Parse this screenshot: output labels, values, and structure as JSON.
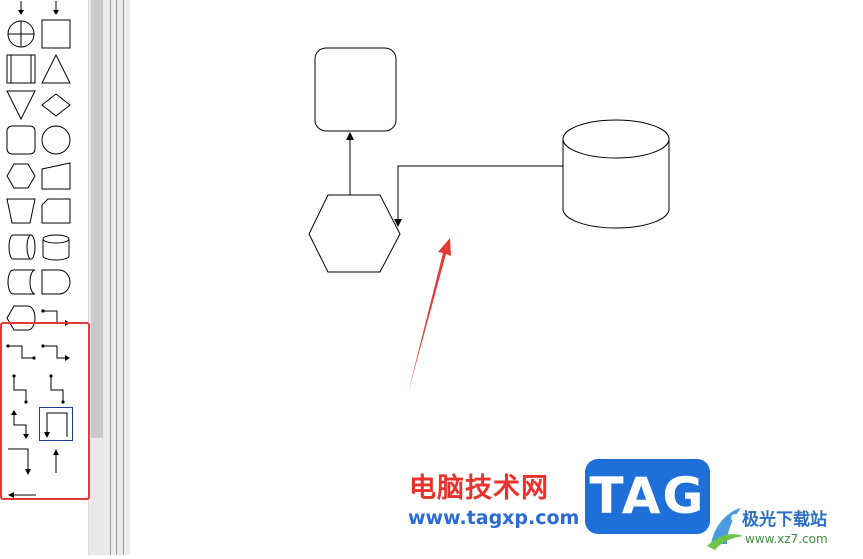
{
  "palette": {
    "items": [
      {
        "row": 0,
        "col": 0,
        "icon": "down-arrow-icon"
      },
      {
        "row": 0,
        "col": 1,
        "icon": "down-arrow-icon"
      },
      {
        "row": 1,
        "col": 0,
        "icon": "summing-junction-icon"
      },
      {
        "row": 1,
        "col": 1,
        "icon": "square-icon"
      },
      {
        "row": 2,
        "col": 0,
        "icon": "predefined-process-icon"
      },
      {
        "row": 2,
        "col": 1,
        "icon": "triangle-icon"
      },
      {
        "row": 3,
        "col": 0,
        "icon": "inverted-triangle-icon"
      },
      {
        "row": 3,
        "col": 1,
        "icon": "diamond-icon"
      },
      {
        "row": 4,
        "col": 0,
        "icon": "rounded-square-icon"
      },
      {
        "row": 4,
        "col": 1,
        "icon": "circle-icon"
      },
      {
        "row": 5,
        "col": 0,
        "icon": "hexagon-icon"
      },
      {
        "row": 5,
        "col": 1,
        "icon": "manual-input-icon"
      },
      {
        "row": 6,
        "col": 0,
        "icon": "manual-operation-icon"
      },
      {
        "row": 6,
        "col": 1,
        "icon": "card-icon"
      },
      {
        "row": 7,
        "col": 0,
        "icon": "horizontal-cylinder-icon"
      },
      {
        "row": 7,
        "col": 1,
        "icon": "cylinder-icon"
      },
      {
        "row": 8,
        "col": 0,
        "icon": "stored-data-icon"
      },
      {
        "row": 8,
        "col": 1,
        "icon": "delay-icon"
      },
      {
        "row": 9,
        "col": 0,
        "icon": "display-icon"
      },
      {
        "row": 9,
        "col": 1,
        "icon": "elbow-connector-icon"
      },
      {
        "row": 10,
        "col": 0,
        "icon": "elbow-connector-dots-icon"
      },
      {
        "row": 10,
        "col": 1,
        "icon": "elbow-connector-arrow-icon"
      },
      {
        "row": 11,
        "col": 0,
        "icon": "vertical-elbow-connector-icon"
      },
      {
        "row": 11,
        "col": 1,
        "icon": "vertical-elbow-connector-dots-icon"
      },
      {
        "row": 12,
        "col": 0,
        "icon": "vertical-elbow-arrow-icon"
      },
      {
        "row": 12,
        "col": 1,
        "icon": "loop-connector-icon",
        "selected": true
      },
      {
        "row": 13,
        "col": 0,
        "icon": "right-angle-arrow-icon"
      },
      {
        "row": 13,
        "col": 1,
        "icon": "up-arrow-icon"
      },
      {
        "row": 14,
        "col": 0,
        "icon": "left-arrow-icon"
      }
    ]
  },
  "diagram": {
    "shapes": [
      "rounded-rectangle",
      "hexagon",
      "cylinder"
    ],
    "connectors": [
      "hexagon-to-rounded-rectangle",
      "cylinder-to-hexagon"
    ]
  },
  "annotations": {
    "highlight_color": "#e53935",
    "arrow_color": "#e53935"
  },
  "watermark": {
    "cn_text": "电脑技术网",
    "url": "www.tagxp.com",
    "tag_logo": "TAG",
    "site_name": "极光下载站",
    "site_url": "www.xz7.com"
  },
  "colors": {
    "watermark_red": "#e8322b",
    "watermark_blue": "#2a6bd8",
    "tag_blue": "#1f6fd8",
    "selected_outline": "#1f3a93"
  }
}
